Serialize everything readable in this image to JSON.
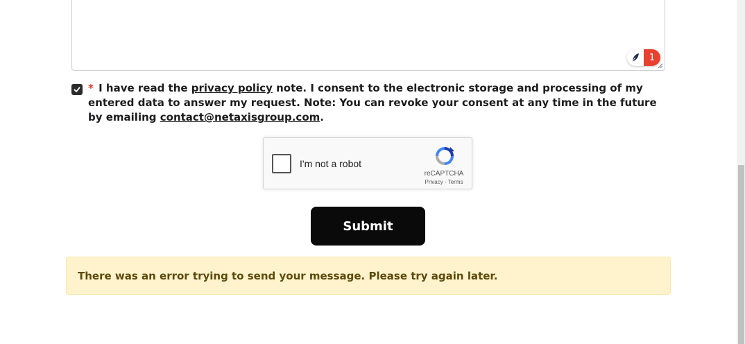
{
  "message_field": {
    "value": "",
    "grammar_issue_count": "1"
  },
  "consent": {
    "checked": true,
    "required_marker": "*",
    "text_before": "I have read the",
    "privacy_link": "privacy policy",
    "text_middle": "note. I consent to the electronic storage and processing of my entered data to answer my request. Note: You can revoke your consent at any time in the future by emailing",
    "email_link": "contact@netaxisgroup.com",
    "text_after": "."
  },
  "recaptcha": {
    "label": "I'm not a robot",
    "brand": "reCAPTCHA",
    "links": "Privacy - Terms",
    "icon": "recaptcha-logo"
  },
  "form": {
    "submit_label": "Submit"
  },
  "alert": {
    "message": "There was an error trying to send your message. Please try again later.",
    "type": "warning"
  },
  "colors": {
    "required": "#d63a2f",
    "submit_bg": "#0a0a0a",
    "alert_bg": "#fff3cd",
    "alert_text": "#5c4a0b",
    "grammar_badge": "#e8412f"
  }
}
